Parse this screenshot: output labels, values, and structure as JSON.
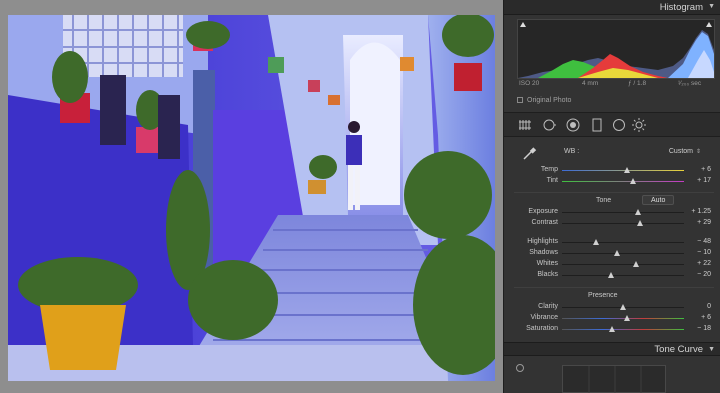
{
  "histogram": {
    "title": "Histogram",
    "iso": "ISO 20",
    "focal": "4 mm",
    "aperture": "ƒ / 1.8",
    "shutter": "¹⁄₂₀₀ sec",
    "original_photo_label": "Original Photo"
  },
  "tools": [
    "crop-icon",
    "spot-removal-icon",
    "red-eye-icon",
    "graduated-filter-icon",
    "radial-filter-icon",
    "adjustment-brush-icon"
  ],
  "basic": {
    "wb_label": "WB :",
    "wb_value": "Custom",
    "wb_arrow": "⇕",
    "tone_label": "Tone",
    "auto_label": "Auto",
    "presence_label": "Presence",
    "sliders": {
      "temp": {
        "label": "Temp",
        "value": "+ 6",
        "pos": 0.53
      },
      "tint": {
        "label": "Tint",
        "value": "+ 17",
        "pos": 0.58
      },
      "exposure": {
        "label": "Exposure",
        "value": "+ 1.25",
        "pos": 0.62
      },
      "contrast": {
        "label": "Contrast",
        "value": "+ 29",
        "pos": 0.64
      },
      "highlights": {
        "label": "Highlights",
        "value": "− 48",
        "pos": 0.28
      },
      "shadows": {
        "label": "Shadows",
        "value": "− 10",
        "pos": 0.45
      },
      "whites": {
        "label": "Whites",
        "value": "+ 22",
        "pos": 0.61
      },
      "blacks": {
        "label": "Blacks",
        "value": "− 20",
        "pos": 0.4
      },
      "clarity": {
        "label": "Clarity",
        "value": "0",
        "pos": 0.5
      },
      "vibrance": {
        "label": "Vibrance",
        "value": "+ 6",
        "pos": 0.53
      },
      "saturation": {
        "label": "Saturation",
        "value": "− 18",
        "pos": 0.41
      }
    }
  },
  "tone_curve": {
    "title": "Tone Curve"
  },
  "colors": {
    "panel_bg": "#333333",
    "header_bg": "#2a2a2a",
    "canvas_bg": "#8e8e8e",
    "wall_blue": "#5a55d8"
  }
}
